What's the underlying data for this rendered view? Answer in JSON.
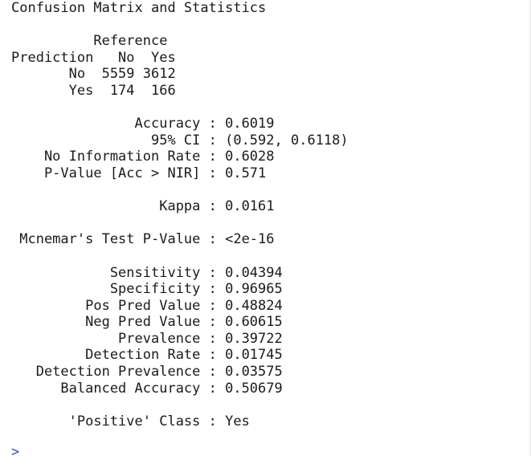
{
  "console": {
    "lines": [
      "Confusion Matrix and Statistics",
      "",
      "          Reference",
      "Prediction   No  Yes",
      "       No  5559 3612",
      "       Yes  174  166",
      "",
      "               Accuracy : 0.6019",
      "                 95% CI : (0.592, 0.6118)",
      "    No Information Rate : 0.6028",
      "    P-Value [Acc > NIR] : 0.571",
      "",
      "                  Kappa : 0.0161",
      "",
      " Mcnemar's Test P-Value : <2e-16",
      "",
      "            Sensitivity : 0.04394",
      "            Specificity : 0.96965",
      "         Pos Pred Value : 0.48824",
      "         Neg Pred Value : 0.60615",
      "             Prevalence : 0.39722",
      "         Detection Rate : 0.01745",
      "   Detection Prevalence : 0.03575",
      "      Balanced Accuracy : 0.50679",
      "",
      "       'Positive' Class : Yes",
      ""
    ],
    "prompt": ">"
  }
}
